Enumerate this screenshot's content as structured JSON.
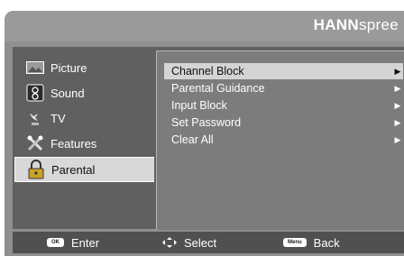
{
  "brand": {
    "bold": "HANN",
    "light": "spree"
  },
  "sidebar": {
    "items": [
      {
        "label": "Picture",
        "icon": "picture-icon",
        "active": false
      },
      {
        "label": "Sound",
        "icon": "speaker-icon",
        "active": false
      },
      {
        "label": "TV",
        "icon": "satellite-dish-icon",
        "active": false
      },
      {
        "label": "Features",
        "icon": "tools-icon",
        "active": false
      },
      {
        "label": "Parental",
        "icon": "padlock-icon",
        "active": true
      }
    ]
  },
  "menu": {
    "items": [
      {
        "label": "Channel Block",
        "selected": true
      },
      {
        "label": "Parental Guidance",
        "selected": false
      },
      {
        "label": "Input Block",
        "selected": false
      },
      {
        "label": "Set Password",
        "selected": false
      },
      {
        "label": "Clear All",
        "selected": false
      }
    ],
    "arrow": "▶"
  },
  "hints": {
    "enter": {
      "key": "OK",
      "label": "Enter"
    },
    "select": {
      "label": "Select"
    },
    "back": {
      "key": "Menu",
      "label": "Back"
    }
  }
}
